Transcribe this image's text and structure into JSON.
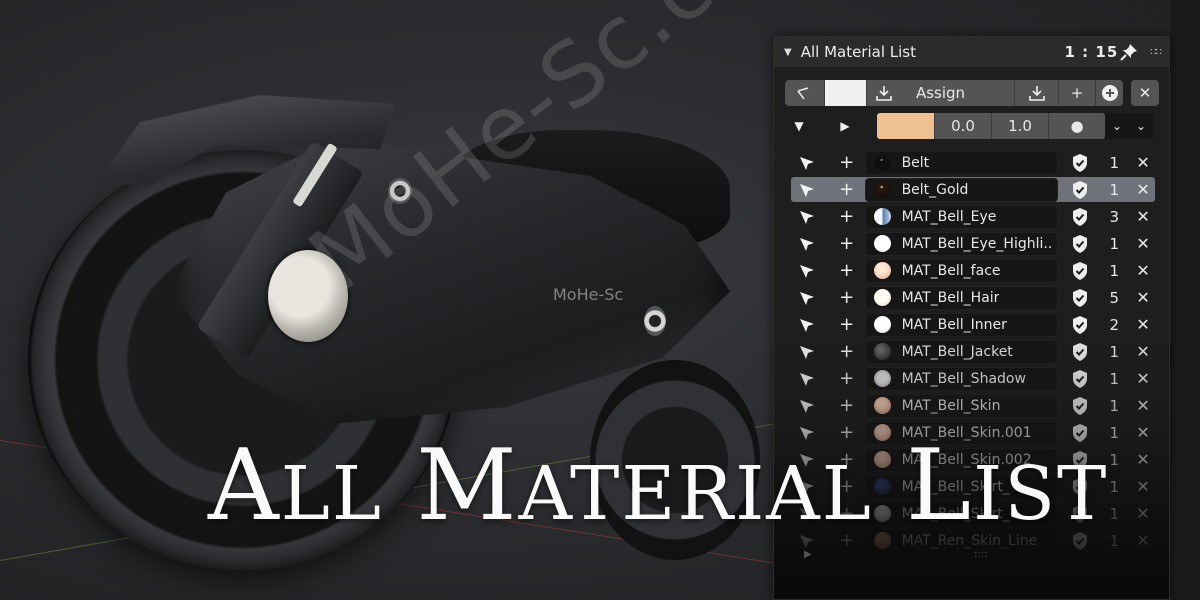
{
  "overlay": {
    "title_words": [
      {
        "cap": "A",
        "rest": "LL"
      },
      {
        "cap": "M",
        "rest": "ATERIAL"
      },
      {
        "cap": "L",
        "rest": "IST"
      }
    ],
    "watermark_large": "MoHe-Sc.com",
    "watermark_small": "MoHe-Sc"
  },
  "panel": {
    "title": "All Material List",
    "count": "1 : 15",
    "icons": {
      "collapse": "triangle-down-icon",
      "pin": "pin-icon",
      "grip": "drag-grip-icon"
    },
    "toolbar": {
      "select_icon": "select-cursor-icon",
      "active_color": "#f0f0f0",
      "assign_label": "Assign",
      "download_icon": "download-icon",
      "add_icon": "plus-icon",
      "new_icon": "plus-circle-icon",
      "close_icon": "close-icon"
    },
    "row2": {
      "color": "#efc190",
      "value_a": "0.0",
      "value_b": "1.0",
      "dot": "●",
      "chevrons": [
        "⌄",
        "⌄"
      ]
    },
    "materials": [
      {
        "name": "Belt",
        "users": "1",
        "ball": "radial-gradient(circle at 45% 35%, #8a8a8a 0 6%, #101010 8% 100%)",
        "selected": false
      },
      {
        "name": "Belt_Gold",
        "users": "1",
        "ball": "radial-gradient(circle at 45% 35%, #d0b090 0 6%, #2a1a10 10%, #0c0807 100%)",
        "selected": true
      },
      {
        "name": "MAT_Bell_Eye",
        "users": "3",
        "ball": "linear-gradient(90deg, #f5f7fa 0 45%, #5d7fb3 55%, #cfd9ea 100%)",
        "selected": false
      },
      {
        "name": "MAT_Bell_Eye_Highli..",
        "users": "1",
        "ball": "radial-gradient(circle at 45% 40%, #ffffff 0 60%, #dcdcdc 100%)",
        "selected": false
      },
      {
        "name": "MAT_Bell_face",
        "users": "1",
        "ball": "radial-gradient(circle at 45% 40%, #fde6d4 0 30%, #e5a987 100%)",
        "selected": false
      },
      {
        "name": "MAT_Bell_Hair",
        "users": "5",
        "ball": "radial-gradient(circle at 45% 40%, #fffdf4 0 45%, #d9cfb6 100%)",
        "selected": false
      },
      {
        "name": "MAT_Bell_Inner",
        "users": "2",
        "ball": "radial-gradient(circle at 45% 40%, #ffffff 0 50%, #d8d8d8 100%)",
        "selected": false
      },
      {
        "name": "MAT_Bell_Jacket",
        "users": "1",
        "ball": "radial-gradient(circle at 40% 40%, #6a6a6a 0 10%, #1c1c1c 100%)",
        "selected": false
      },
      {
        "name": "MAT_Bell_Shadow",
        "users": "1",
        "ball": "radial-gradient(ellipse at 50% 50%, #e0e0e0 0 40%, #8c8c8c 100%)",
        "selected": false
      },
      {
        "name": "MAT_Bell_Skin",
        "users": "1",
        "ball": "radial-gradient(circle at 45% 40%, #f6d1bd 0 25%, #c98a6c 100%)",
        "selected": false
      },
      {
        "name": "MAT_Bell_Skin.001",
        "users": "1",
        "ball": "radial-gradient(circle at 45% 40%, #f6d1bd 0 25%, #c98a6c 100%)",
        "selected": false
      },
      {
        "name": "MAT_Bell_Skin.002",
        "users": "1",
        "ball": "radial-gradient(circle at 45% 40%, #f6d1bd 0 25%, #c98a6c 100%)",
        "selected": false
      },
      {
        "name": "MAT_Bell_Skirt_",
        "users": "1",
        "ball": "radial-gradient(circle at 45% 40%, #3a4a8a 0 20%, #101830 100%)",
        "selected": false
      },
      {
        "name": "MAT_Bell_Skirt_",
        "users": "1",
        "ball": "radial-gradient(circle at 45% 40%, #eeeeee 0 35%, #9a9a9a 100%)",
        "selected": false
      },
      {
        "name": "MAT_Ren_Skin_Line",
        "users": "1",
        "ball": "radial-gradient(circle at 45% 40%, #e5a98b 0 25%, #b0705a 100%)",
        "selected": false
      }
    ]
  }
}
